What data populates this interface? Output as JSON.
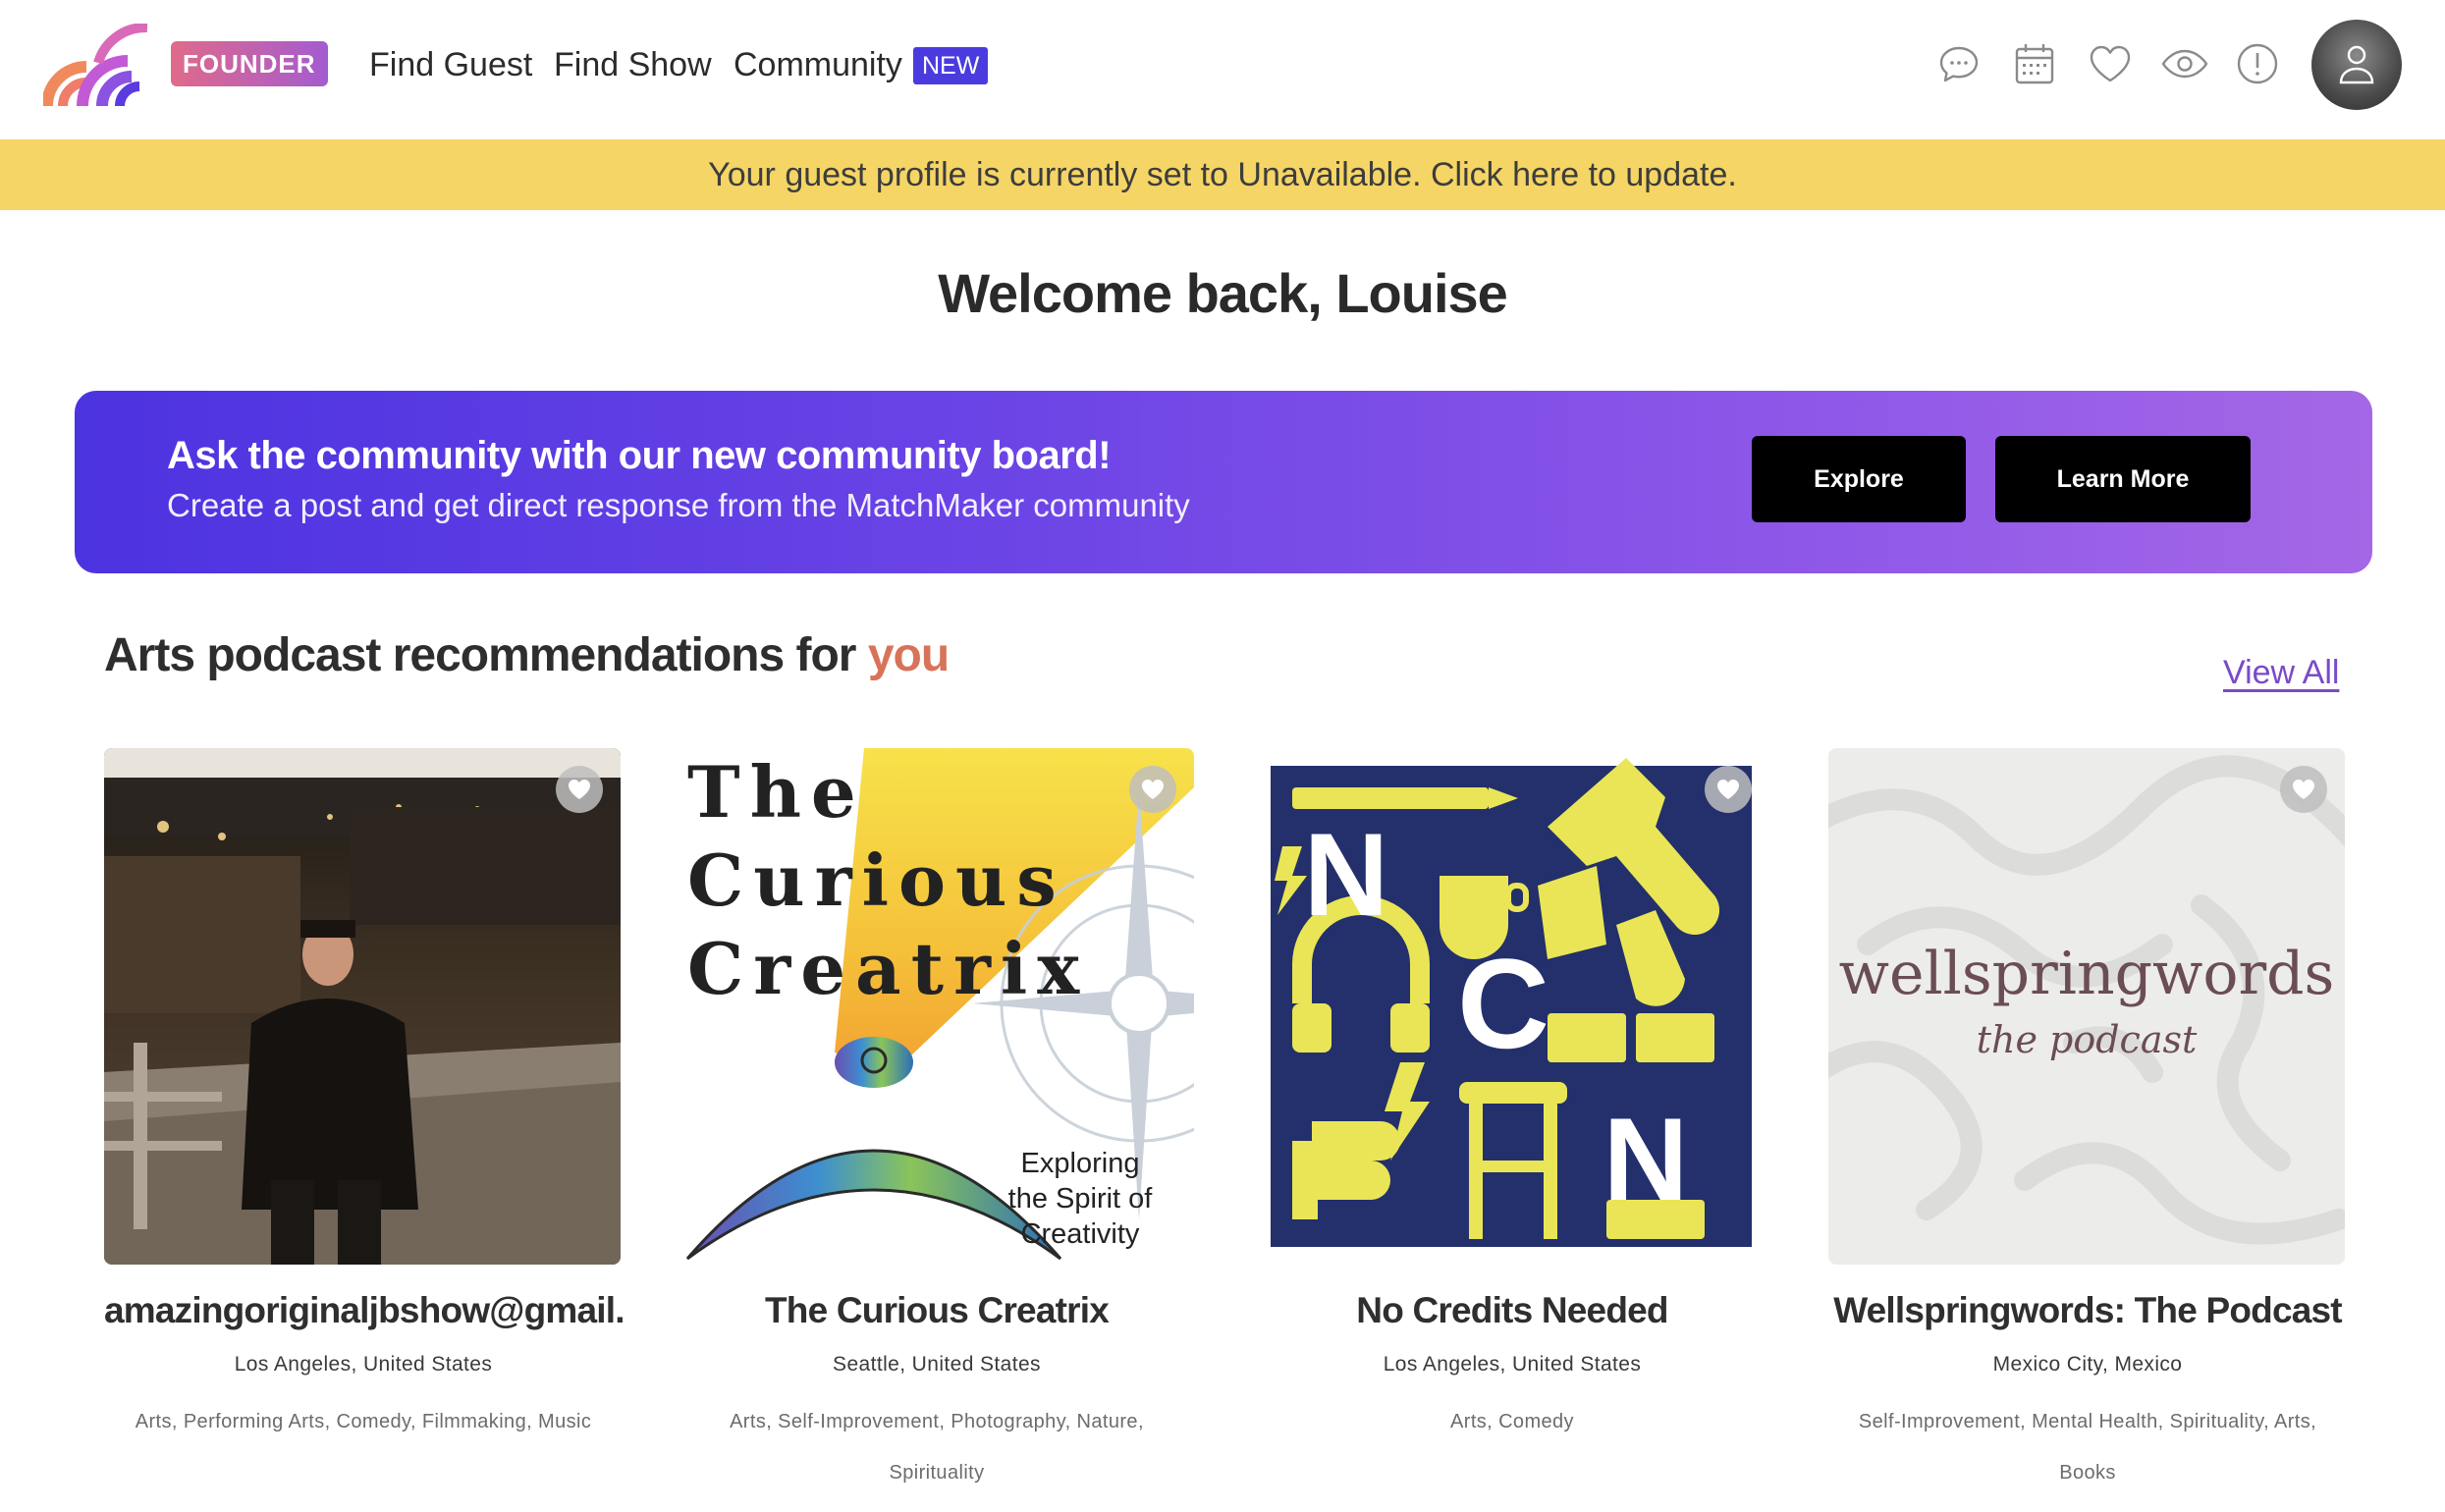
{
  "header": {
    "founder_badge": "FOUNDER",
    "nav": {
      "find_guest": "Find Guest",
      "find_show": "Find Show",
      "community": "Community",
      "new_badge": "NEW"
    },
    "icons": [
      "chat-icon",
      "calendar-icon",
      "heart-icon",
      "eye-icon",
      "alert-icon",
      "user-icon"
    ]
  },
  "status_banner": "Your guest profile is currently set to Unavailable. Click here to update.",
  "welcome": "Welcome back, Louise",
  "promo": {
    "title": "Ask the community with our new community board!",
    "subtitle": "Create a post and get direct response from the MatchMaker community",
    "explore_label": "Explore",
    "learn_more_label": "Learn More"
  },
  "section": {
    "title_prefix": "Arts podcast recommendations for ",
    "title_accent": "you",
    "view_all": "View All"
  },
  "cards": [
    {
      "name": "amazingoriginaljbshow@gmail.c...",
      "location": "Los Angeles, United States",
      "tags": "Arts, Performing Arts, Comedy, Filmmaking, Music"
    },
    {
      "name": "The Curious Creatrix",
      "location": "Seattle, United States",
      "tags": "Arts, Self-Improvement, Photography, Nature, Spirituality",
      "art": {
        "title_lines": [
          "The",
          "Curious",
          "Creatrix"
        ],
        "tagline_lines": [
          "Exploring",
          "the Spirit of",
          "Creativity"
        ]
      }
    },
    {
      "name": "No Credits Needed",
      "location": "Los Angeles, United States",
      "tags": "Arts, Comedy",
      "art": {
        "letters": [
          "N",
          "C",
          "N"
        ]
      }
    },
    {
      "name": "Wellspringwords: The Podcast",
      "location": "Mexico City, Mexico",
      "tags": "Self-Improvement, Mental Health, Spirituality, Arts, Books",
      "art": {
        "title": "wellspringwords",
        "subtitle": "the podcast"
      }
    }
  ],
  "colors": {
    "banner_yellow": "#f5d565",
    "promo_start": "#4c33e0",
    "promo_end": "#a467e6",
    "accent_orange": "#d8735a",
    "link_purple": "#7a49c9",
    "new_badge": "#4a3bde"
  }
}
